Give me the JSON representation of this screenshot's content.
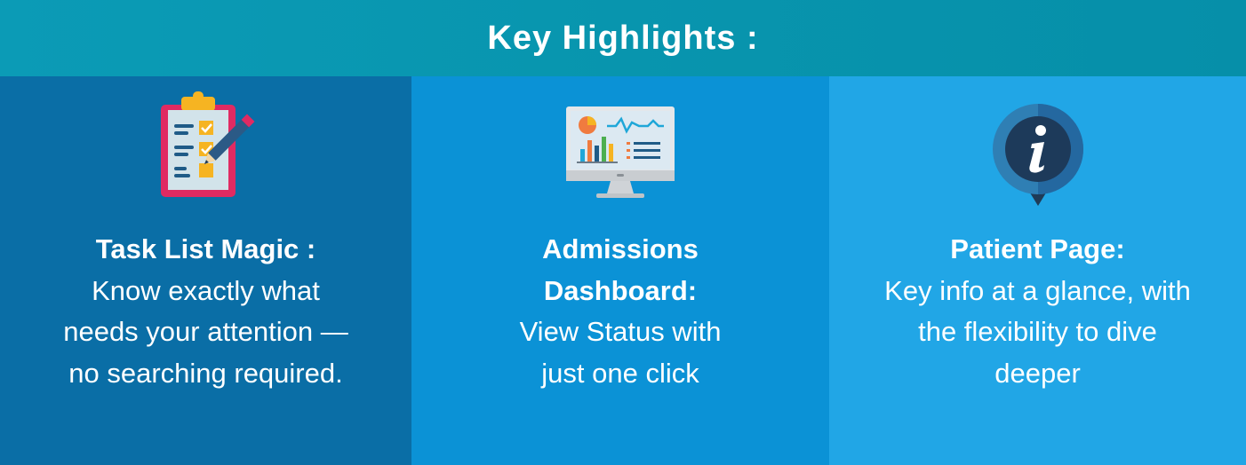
{
  "header": {
    "title": "Key Highlights :"
  },
  "highlights": [
    {
      "icon": "checklist-icon",
      "title": "Task List Magic :",
      "description": "Know exactly what needs your attention — no searching required."
    },
    {
      "icon": "dashboard-monitor-icon",
      "title": "Admissions Dashboard:",
      "description": "View Status with just one click"
    },
    {
      "icon": "info-pin-icon",
      "title": "Patient Page:",
      "description": "Key info at a glance, with the flexibility to dive deeper"
    }
  ],
  "colors": {
    "header_bg": "#0895ae",
    "column_1_bg": "#0a6ea6",
    "column_2_bg": "#0b92d6",
    "column_3_bg": "#21a6e6",
    "text": "#ffffff"
  }
}
